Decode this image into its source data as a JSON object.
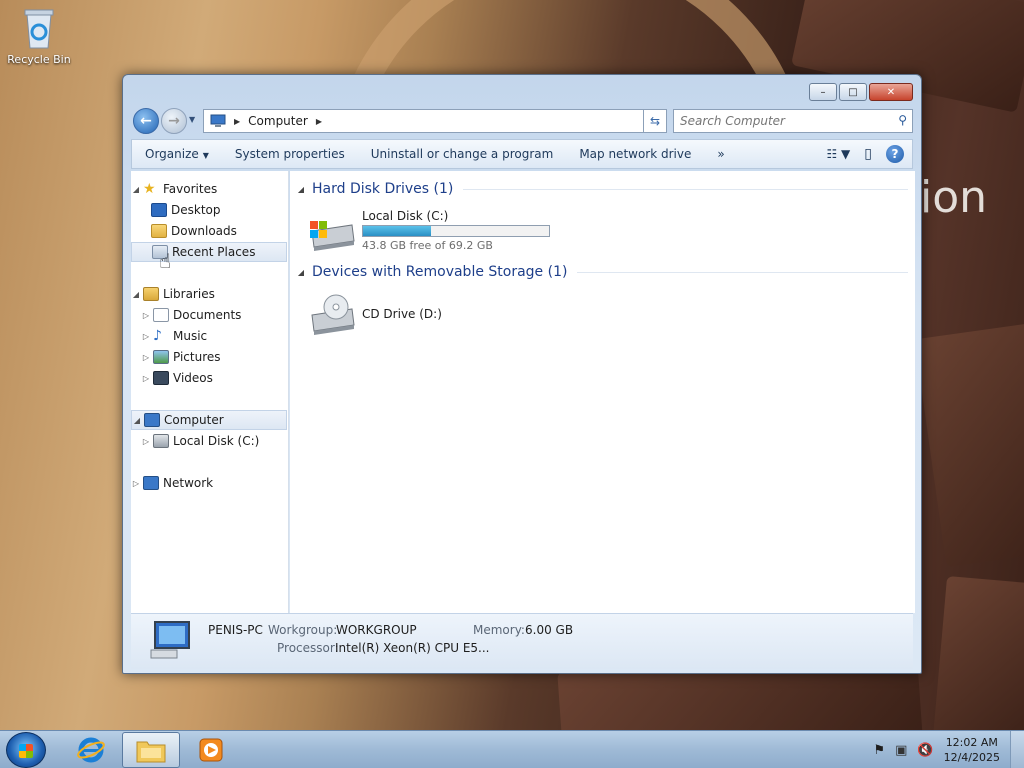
{
  "desktop": {
    "recycle_bin_label": "Recycle Bin",
    "wallpaper_text": "ion"
  },
  "window": {
    "caption": {
      "minimize": "–",
      "maximize": "□",
      "close": "✕"
    },
    "address": {
      "root_icon": "computer-icon",
      "crumb": "Computer"
    },
    "search": {
      "placeholder": "Search Computer"
    },
    "toolbar": {
      "organize": "Organize",
      "system_properties": "System properties",
      "uninstall": "Uninstall or change a program",
      "map_drive": "Map network drive",
      "more": "»"
    },
    "nav": {
      "favorites": "Favorites",
      "desktop": "Desktop",
      "downloads": "Downloads",
      "recent_places": "Recent Places",
      "libraries": "Libraries",
      "documents": "Documents",
      "music": "Music",
      "pictures": "Pictures",
      "videos": "Videos",
      "computer": "Computer",
      "local_disk": "Local Disk (C:)",
      "network": "Network"
    },
    "content": {
      "hdd_group": "Hard Disk Drives (1)",
      "local_disk_name": "Local Disk (C:)",
      "local_disk_free": "43.8 GB free of 69.2 GB",
      "local_disk_used_fraction": 0.367,
      "removable_group": "Devices with Removable Storage (1)",
      "cd_drive_name": "CD Drive (D:)"
    },
    "details": {
      "pc_name": "PENIS-PC",
      "workgroup_label": "Workgroup:",
      "workgroup_value": "WORKGROUP",
      "memory_label": "Memory:",
      "memory_value": "6.00 GB",
      "processor_label": "Processor:",
      "processor_value": "Intel(R) Xeon(R) CPU E5..."
    }
  },
  "taskbar": {
    "clock_time": "12:02 AM",
    "clock_date": "12/4/2025"
  }
}
